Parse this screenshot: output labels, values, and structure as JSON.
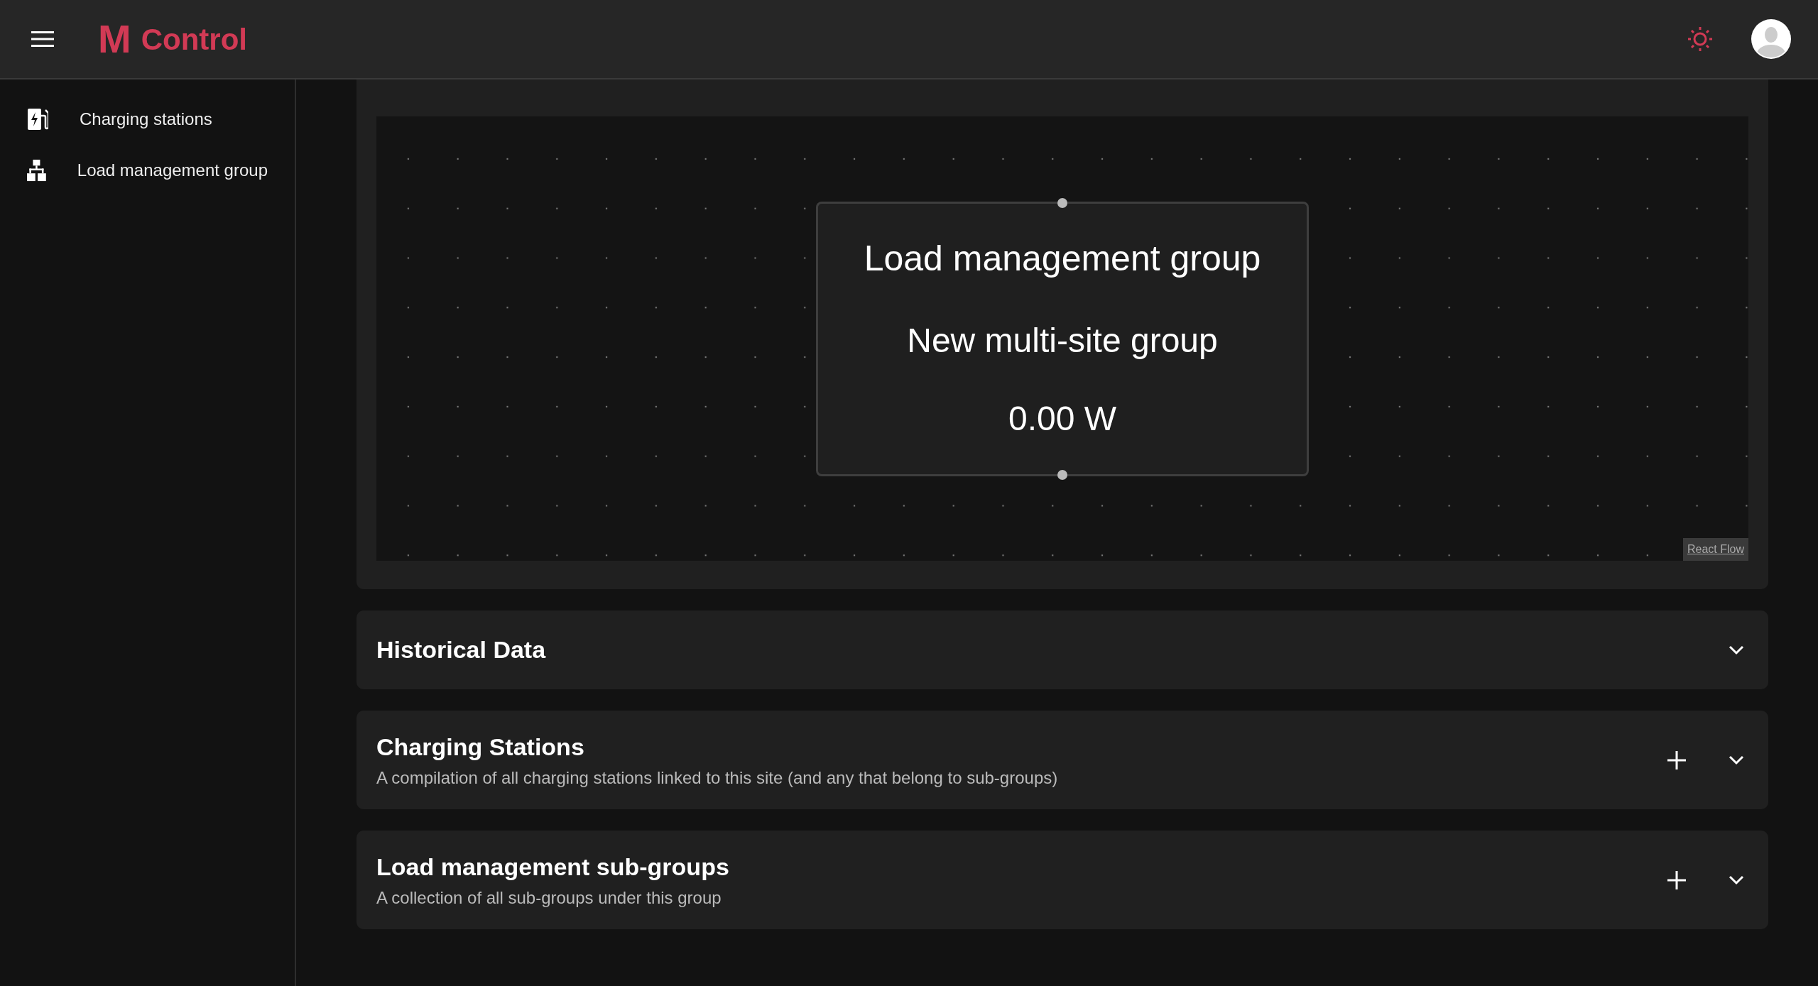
{
  "header": {
    "logo_mark": "M",
    "logo_text": "Control"
  },
  "sidebar": {
    "items": [
      {
        "label": "Charging stations",
        "kind": "charger",
        "selected": false
      },
      {
        "label": "Load management group",
        "kind": "hierarchy",
        "selected": false
      }
    ]
  },
  "flow": {
    "node": {
      "title": "Load management group",
      "name": "New multi-site group",
      "power": "0.00 W"
    },
    "attribution": "React Flow"
  },
  "sections": [
    {
      "title": "Historical Data",
      "addable": false,
      "expanded": false
    },
    {
      "title": "Charging Stations",
      "description": "A compilation of all charging stations linked to this site (and any that belong to sub-groups)",
      "addable": true,
      "expanded": false
    },
    {
      "title": "Load management sub-groups",
      "description": "A collection of all sub-groups under this group",
      "addable": true,
      "expanded": false
    }
  ]
}
